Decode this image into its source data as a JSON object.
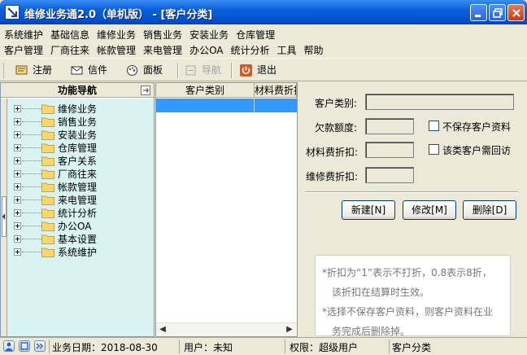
{
  "window": {
    "title": "维修业务通2.0（单机版） - [客户分类]"
  },
  "menus": {
    "row1": [
      "系统维护",
      "基础信息",
      "维修业务",
      "销售业务",
      "安装业务",
      "仓库管理"
    ],
    "row2": [
      "客户管理",
      "厂商往来",
      "帐款管理",
      "来电管理",
      "办公OA",
      "统计分析",
      "工具",
      "帮助"
    ]
  },
  "toolbar": {
    "register": "注册",
    "mail": "信件",
    "panel": "面板",
    "navigate": "导航",
    "exit": "退出"
  },
  "nav": {
    "header": "功能导航",
    "items": [
      "维修业务",
      "销售业务",
      "安装业务",
      "仓库管理",
      "客户关系",
      "厂商往来",
      "帐款管理",
      "来电管理",
      "统计分析",
      "办公OA",
      "基本设置",
      "系统维护"
    ]
  },
  "grid": {
    "columns": [
      "客户类别",
      "材料费折扣"
    ]
  },
  "form": {
    "category_label": "客户类别:",
    "credit_label": "欠款额度:",
    "material_label": "材料费折扣:",
    "repair_label": "维修费折扣:",
    "no_save_label": "不保存客户资料",
    "callback_label": "该类客户需回访",
    "new_button": "新建[N]",
    "edit_button": "修改[M]",
    "delete_button": "删除[D]"
  },
  "notes": {
    "line1": "*折扣为“1”表示不打折，0.8表示8折，",
    "line2": "该折扣在结算时生效。",
    "line3": "*选择不保存客户资料，则客户资料在业",
    "line4": "务完成后删除掉。"
  },
  "status": {
    "business_date": "业务日期：2018-08-30",
    "user": "用户：未知",
    "permission": "权限：超级用户",
    "current_module": "客户分类"
  },
  "colors": {
    "title_bar": "#0a5fd8",
    "nav_background": "#d9f2f2",
    "selection": "#3399ff"
  }
}
